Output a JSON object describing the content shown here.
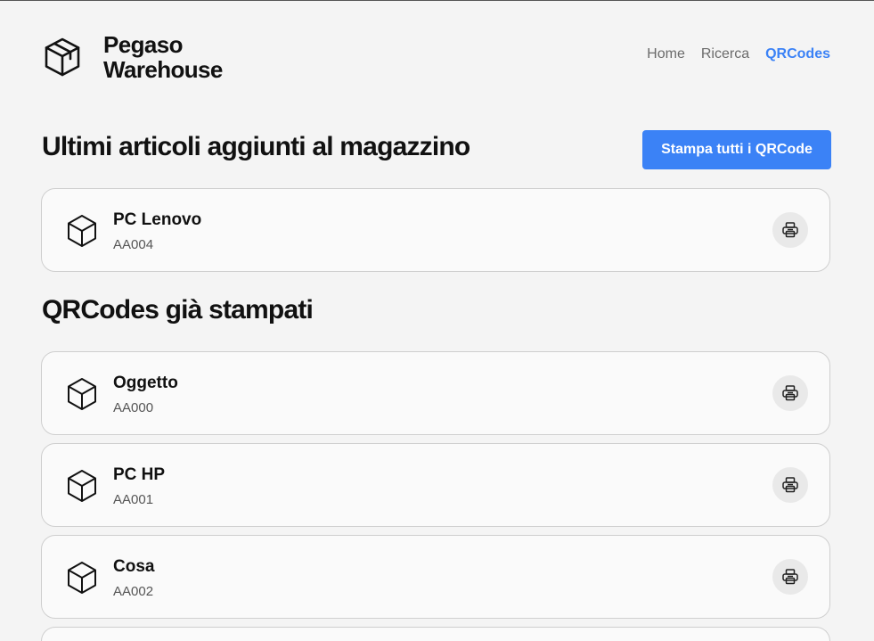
{
  "header": {
    "brand_line1": "Pegaso",
    "brand_line2": "Warehouse",
    "nav": [
      {
        "label": "Home"
      },
      {
        "label": "Ricerca"
      },
      {
        "label": "QRCodes"
      }
    ],
    "active_nav": "QRCodes"
  },
  "recent": {
    "title": "Ultimi articoli aggiunti al magazzino",
    "print_all_label": "Stampa tutti i QRCode",
    "items": [
      {
        "name": "PC Lenovo",
        "code": "AA004"
      }
    ]
  },
  "printed": {
    "title": "QRCodes già stampati",
    "items": [
      {
        "name": "Oggetto",
        "code": "AA000"
      },
      {
        "name": "PC HP",
        "code": "AA001"
      },
      {
        "name": "Cosa",
        "code": "AA002"
      }
    ]
  },
  "icons": {
    "brand": "package-icon",
    "item": "cube-icon",
    "print": "printer-icon"
  },
  "colors": {
    "accent": "#3b82f6",
    "background": "#f4f4f4",
    "card": "#fafafa"
  }
}
